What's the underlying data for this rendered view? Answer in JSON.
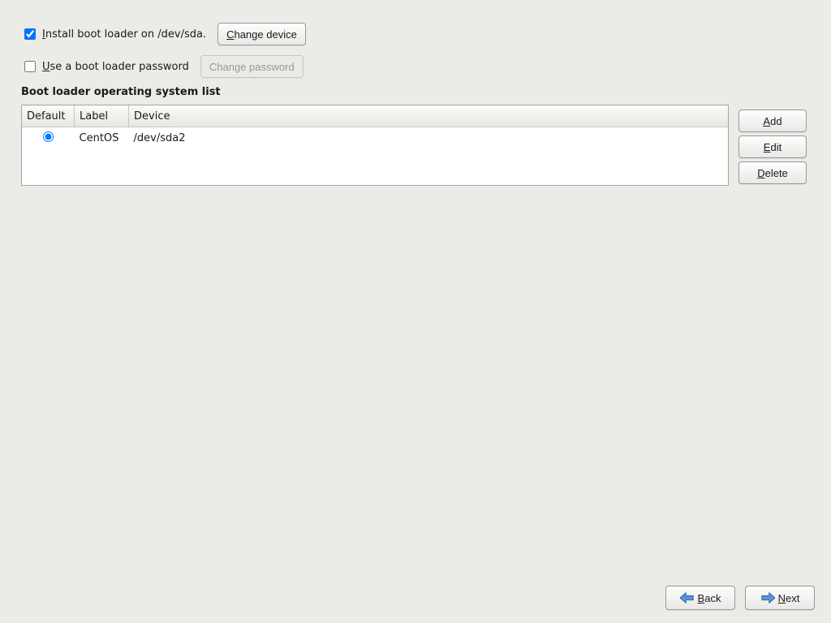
{
  "installRow": {
    "checked": true,
    "labelBefore": "nstall boot loader on /dev/sda.",
    "mnemonic": "I",
    "buttonBefore": "hange device",
    "buttonMnemonic": "C"
  },
  "passwordRow": {
    "checked": false,
    "labelBefore": "se a boot loader password",
    "mnemonic": "U",
    "buttonLabel": "Change password"
  },
  "sectionTitle": "Boot loader operating system list",
  "columns": {
    "default": "Default",
    "label": "Label",
    "device": "Device"
  },
  "rows": [
    {
      "default": true,
      "label": "CentOS",
      "device": "/dev/sda2"
    }
  ],
  "sideButtons": {
    "add": {
      "mn": "A",
      "rest": "dd"
    },
    "edit": {
      "mn": "E",
      "rest": "dit"
    },
    "delete": {
      "mn": "D",
      "rest": "elete"
    }
  },
  "nav": {
    "back": {
      "mn": "B",
      "rest": "ack"
    },
    "next": {
      "mn": "N",
      "rest": "ext"
    }
  }
}
